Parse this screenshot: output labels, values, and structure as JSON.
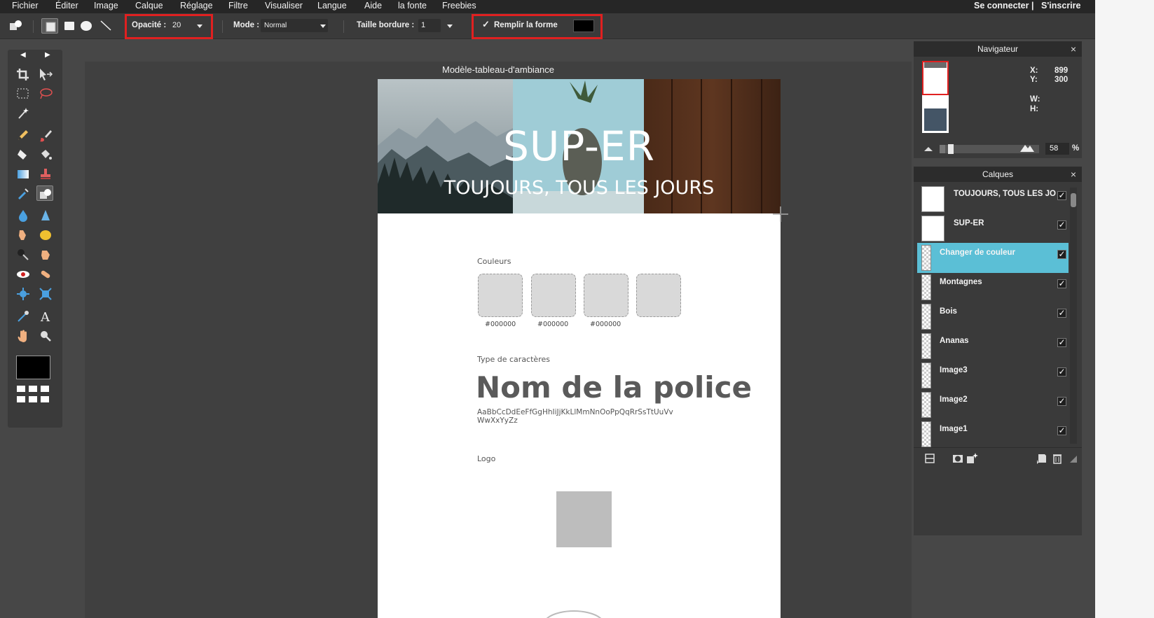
{
  "menu": {
    "items": [
      "Fichier",
      "Éditer",
      "Image",
      "Calque",
      "Réglage",
      "Filtre",
      "Visualiser",
      "Langue",
      "Aide",
      "la fonte",
      "Freebies"
    ],
    "login": "Se connecter",
    "separator": "|",
    "signup": "S'inscrire"
  },
  "options": {
    "opacity_label": "Opacité :",
    "opacity_value": "20",
    "mode_label": "Mode :",
    "mode_value": "Normal",
    "border_label": "Taille bordure :",
    "border_value": "1",
    "fill_check": "✓",
    "fill_label": "Remplir la forme",
    "fill_color": "#000000",
    "highlight_color": "#e02020"
  },
  "toolbox": {
    "tools": [
      "crop-icon",
      "move-icon",
      "marquee-icon",
      "lasso-icon",
      "magic-wand-icon",
      "pencil-icon",
      "brush-icon",
      "eraser-icon",
      "bucket-icon",
      "gradient-icon",
      "clone-stamp-icon",
      "color-replace-icon",
      "shape-icon",
      "drop-icon",
      "sharpen-icon",
      "smudge-icon",
      "sponge-icon",
      "burn-icon",
      "dodge-icon",
      "red-eye-icon",
      "spot-heal-icon",
      "bloat-icon",
      "pinch-icon",
      "color-picker-icon",
      "text-icon",
      "hand-icon",
      "zoom-icon"
    ],
    "primary_color": "#000000"
  },
  "document": {
    "title": "Modèle-tableau-d'ambiance",
    "hero_title": "SUP-ER",
    "hero_subtitle": "TOUJOURS, TOUS LES JOURS",
    "colors_heading": "Couleurs",
    "swatch_codes": [
      "#000000",
      "#000000",
      "#000000"
    ],
    "type_heading": "Type de caractères",
    "font_name": "Nom de la police",
    "font_sample": "AaBbCcDdEeFfGgHhIiJjKkLlMmNnOoPpQqRrSsTtUuVv WwXxYyZz",
    "logo_heading": "Logo"
  },
  "navigator": {
    "title": "Navigateur",
    "close": "×",
    "x_label": "X:",
    "x_value": "899",
    "y_label": "Y:",
    "y_value": "300",
    "w_label": "W:",
    "h_label": "H:",
    "zoom_value": "58",
    "zoom_unit": "%"
  },
  "layers": {
    "title": "Calques",
    "close": "×",
    "items": [
      {
        "name": "TOUJOURS, TOUS LES JO",
        "selected": false
      },
      {
        "name": "SUP-ER",
        "selected": false
      },
      {
        "name": "Changer de couleur",
        "selected": true
      },
      {
        "name": "Montagnes",
        "selected": false
      },
      {
        "name": "Bois",
        "selected": false
      },
      {
        "name": "Ananas",
        "selected": false
      },
      {
        "name": "Image3",
        "selected": false
      },
      {
        "name": "Image2",
        "selected": false
      },
      {
        "name": "Image1",
        "selected": false
      }
    ],
    "check": "✓",
    "selected_color": "#5bbfd6"
  }
}
